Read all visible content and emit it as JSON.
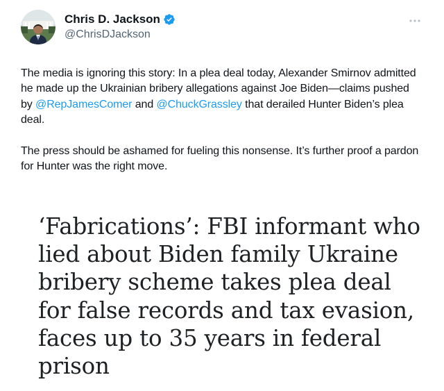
{
  "author": {
    "name": "Chris D. Jackson",
    "handle": "@ChrisDJackson",
    "verified": true,
    "avatar_icon": "avatar-photo",
    "verified_color": "#1d9bf0"
  },
  "more_icon": "ellipsis-icon",
  "tweet": {
    "paragraph1": {
      "part1": "The media is ignoring this story: In a plea deal today, Alexander Smirnov admitted he made up the Ukrainian bribery allegations against Joe Biden—claims pushed by ",
      "mention1": "@RepJamesComer",
      "part2": " and ",
      "mention2": "@ChuckGrassley",
      "part3": " that derailed Hunter Biden’s plea deal."
    },
    "paragraph2": "The press should be ashamed for fueling this nonsense. It’s further proof a pardon for Hunter was the right move."
  },
  "article": {
    "headline": "‘Fabrications’: FBI informant who lied about Biden family Ukraine bribery scheme takes plea deal for false records and tax evasion, faces up to 35 years in federal prison"
  },
  "colors": {
    "text": "#0f1419",
    "secondary": "#536471",
    "link": "#1d9bf0",
    "headline": "#1e2123"
  }
}
